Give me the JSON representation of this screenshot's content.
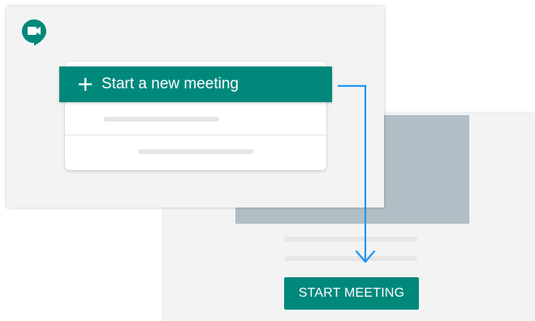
{
  "landing": {
    "new_meeting_label": "Start a new meeting"
  },
  "meeting": {
    "start_label": "START MEETING"
  },
  "colors": {
    "accent": "#00897b",
    "logo": "#00897b",
    "arrow": "#2196f3",
    "video_placeholder": "#b0bec5",
    "panel_background": "#f3f3f3"
  },
  "icons": {
    "logo": "google-meet-logo-icon",
    "plus": "plus-icon",
    "arrow": "flow-arrow"
  }
}
